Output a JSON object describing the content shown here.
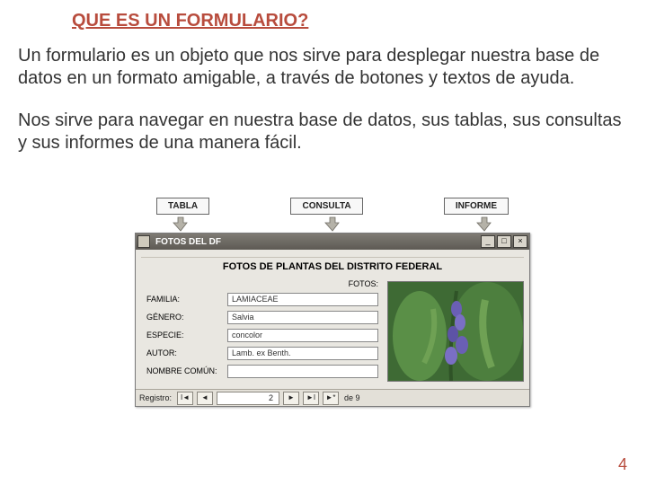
{
  "title": "QUE ES UN FORMULARIO?",
  "paragraph1": "Un formulario es un objeto que nos sirve para desplegar nuestra base de datos en un formato amigable, a través de botones y textos de ayuda.",
  "paragraph2": "Nos sirve para navegar en nuestra base de datos, sus tablas, sus consultas y sus informes de una manera fácil.",
  "topBoxes": {
    "tabla": "TABLA",
    "consulta": "CONSULTA",
    "informe": "INFORME"
  },
  "window": {
    "title": "FOTOS DEL DF",
    "heading": "FOTOS DE PLANTAS DEL DISTRITO FEDERAL",
    "fotosLabel": "FOTOS:",
    "fields": {
      "familia": {
        "label": "FAMILIA:",
        "value": "LAMIACEAE"
      },
      "genero": {
        "label": "GÉNERO:",
        "value": "Salvia"
      },
      "especie": {
        "label": "ESPECIE:",
        "value": "concolor"
      },
      "autor": {
        "label": "AUTOR:",
        "value": "Lamb. ex Benth."
      },
      "nombrecomun": {
        "label": "NOMBRE COMÚN:",
        "value": ""
      }
    },
    "nav": {
      "label": "Registro:",
      "current": "2",
      "deLabel": "de 9",
      "first": "I◄",
      "prev": "◄",
      "next": "►",
      "last": "►I",
      "new": "►*"
    },
    "buttons": {
      "min": "_",
      "max": "□",
      "close": "×"
    }
  },
  "pageNumber": "4"
}
